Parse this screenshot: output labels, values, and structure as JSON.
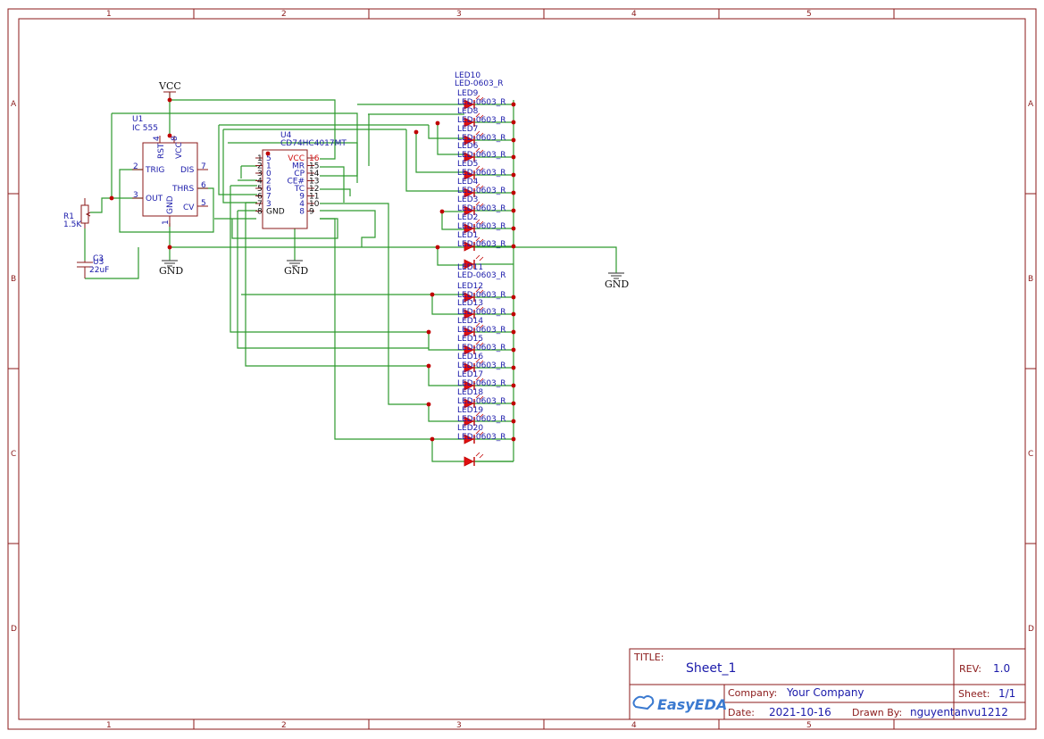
{
  "frame": {
    "columns": [
      "1",
      "2",
      "3",
      "4",
      "5"
    ],
    "rows": [
      "A",
      "B",
      "C",
      "D"
    ]
  },
  "nets": {
    "vcc": "VCC",
    "gnd": "GND"
  },
  "u1": {
    "ref": "U1",
    "value": "IC 555",
    "pins": {
      "rst": "RST",
      "vcc": "VCC",
      "trig": "TRIG",
      "dis": "DIS",
      "out": "OUT",
      "thrs": "THRS",
      "gnd": "GND",
      "cv": "CV",
      "n4": "4",
      "n8": "8",
      "n2": "2",
      "n7": "7",
      "n3": "3",
      "n6": "6",
      "n1": "1",
      "n5": "5"
    }
  },
  "r1": {
    "ref": "R1",
    "value": "1.5K"
  },
  "c3": {
    "ref": "C3",
    "value": "22uF",
    "overlap": "U3"
  },
  "u4": {
    "ref": "U4",
    "value": "CD74HC4017MT",
    "left_pins": [
      {
        "num": "1",
        "name": "5"
      },
      {
        "num": "2",
        "name": "1"
      },
      {
        "num": "3",
        "name": "0"
      },
      {
        "num": "4",
        "name": "2"
      },
      {
        "num": "5",
        "name": "6"
      },
      {
        "num": "6",
        "name": "7"
      },
      {
        "num": "7",
        "name": "3"
      },
      {
        "num": "8",
        "name": "GND"
      }
    ],
    "right_pins": [
      {
        "num": "16",
        "name": "VCC"
      },
      {
        "num": "15",
        "name": "MR"
      },
      {
        "num": "14",
        "name": "CP"
      },
      {
        "num": "13",
        "name": "CE#"
      },
      {
        "num": "12",
        "name": "TC"
      },
      {
        "num": "11",
        "name": "9"
      },
      {
        "num": "10",
        "name": "4"
      },
      {
        "num": "9",
        "name": "8"
      }
    ]
  },
  "leds": {
    "top_ref": "LED10",
    "package": "LED-0603_R",
    "upper_refs": [
      "LED9",
      "LED8",
      "LED7",
      "LED6",
      "LED5",
      "LED4",
      "LED3",
      "LED2",
      "LED1"
    ],
    "mid_ref": "LED11",
    "lower_refs": [
      "LED12",
      "LED13",
      "LED14",
      "LED15",
      "LED16",
      "LED17",
      "LED18",
      "LED19",
      "LED20"
    ]
  },
  "title_block": {
    "title_label": "TITLE:",
    "title": "Sheet_1",
    "rev_label": "REV:",
    "rev": "1.0",
    "company_label": "Company:",
    "company": "Your Company",
    "sheet_label": "Sheet:",
    "sheet": "1/1",
    "date_label": "Date:",
    "date": "2021-10-16",
    "drawn_label": "Drawn By:",
    "drawn_by": "nguyentanvu1212",
    "logo": "EasyEDA"
  },
  "colors": {
    "frame": "#8b1a1a",
    "wire": "#2e9a2e",
    "junction": "#c00000",
    "led": "#e01010",
    "label_blue": "#1a1aaa"
  }
}
